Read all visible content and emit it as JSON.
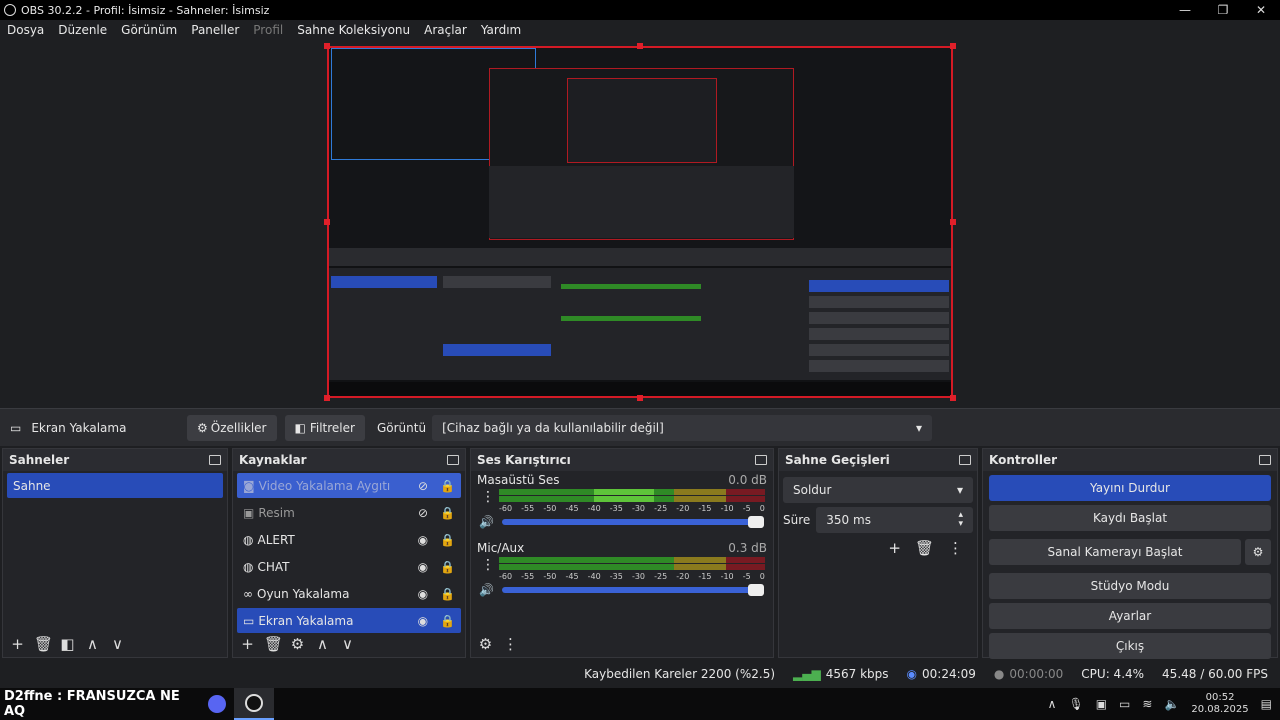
{
  "window": {
    "title": "OBS 30.2.2 - Profil: İsimsiz - Sahneler: İsimsiz",
    "controls": [
      "—",
      "❐",
      "✕"
    ]
  },
  "menu": [
    "Dosya",
    "Düzenle",
    "Görünüm",
    "Paneller",
    "Profil",
    "Sahne Koleksiyonu",
    "Araçlar",
    "Yardım"
  ],
  "sourcebar": {
    "source_name": "Ekran Yakalama",
    "properties_label": "Özellikler",
    "filters_label": "Filtreler",
    "display_label": "Görüntü",
    "display_value": "[Cihaz bağlı ya da kullanılabilir değil]"
  },
  "scenes": {
    "title": "Sahneler",
    "items": [
      "Sahne"
    ]
  },
  "sources": {
    "title": "Kaynaklar",
    "items": [
      {
        "label": "Video Yakalama Aygıtı",
        "icon": "camera-icon",
        "visible": false
      },
      {
        "label": "Resim",
        "icon": "image-icon",
        "visible": false
      },
      {
        "label": "ALERT",
        "icon": "browser-icon",
        "visible": true
      },
      {
        "label": "CHAT",
        "icon": "browser-icon",
        "visible": true
      },
      {
        "label": "Oyun Yakalama",
        "icon": "gamepad-icon",
        "visible": true
      },
      {
        "label": "Ekran Yakalama",
        "icon": "monitor-icon",
        "visible": true
      }
    ]
  },
  "mixer": {
    "title": "Ses Karıştırıcı",
    "channels": [
      {
        "name": "Masaüstü Ses",
        "level": "0.0 dB"
      },
      {
        "name": "Mic/Aux",
        "level": "0.3 dB"
      }
    ],
    "ticks": [
      "-60",
      "-55",
      "-50",
      "-45",
      "-40",
      "-35",
      "-30",
      "-25",
      "-20",
      "-15",
      "-10",
      "-5",
      "0"
    ]
  },
  "transitions": {
    "title": "Sahne Geçişleri",
    "type": "Soldur",
    "duration_label": "Süre",
    "duration_value": "350 ms"
  },
  "controls": {
    "title": "Kontroller",
    "stop_stream": "Yayını Durdur",
    "start_record": "Kaydı Başlat",
    "start_vcam": "Sanal Kamerayı Başlat",
    "studio_mode": "Stüdyo Modu",
    "settings": "Ayarlar",
    "exit": "Çıkış"
  },
  "status": {
    "dropped": "Kaybedilen Kareler 2200 (%2.5)",
    "bitrate": "4567 kbps",
    "stream_time": "00:24:09",
    "rec_time": "00:00:00",
    "cpu": "CPU: 4.4%",
    "fps": "45.48 / 60.00 FPS"
  },
  "taskbar": {
    "pinned_text": "D2ffne : FRANSUZCA NE AQ",
    "time": "00:52",
    "date": "20.08.2025"
  },
  "colors": {
    "accent": "#284cb8",
    "selection_red": "#d41a25",
    "meter_green": "#2f8a26",
    "meter_yellow": "#8a7a1e",
    "meter_red": "#781a22"
  }
}
